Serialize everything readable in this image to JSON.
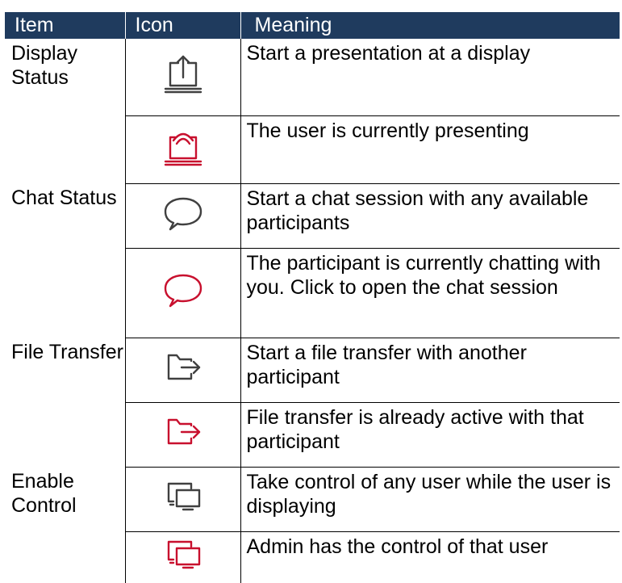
{
  "header": {
    "item": "Item",
    "icon": "Icon",
    "meaning": "Meaning"
  },
  "colors": {
    "header_bg": "#1f3b5e",
    "icon_default": "#404040",
    "icon_active": "#c8102e"
  },
  "rows": [
    {
      "item": "Display Status",
      "icon": "share-screen-icon",
      "icon_color": "default",
      "meaning": "Start a presentation at a display"
    },
    {
      "item": "",
      "icon": "presenting-icon",
      "icon_color": "active",
      "meaning": "The user is currently presenting"
    },
    {
      "item": "Chat Status",
      "icon": "chat-bubble-icon",
      "icon_color": "default",
      "meaning": "Start a chat session with any available participants"
    },
    {
      "item": "",
      "icon": "chat-bubble-icon",
      "icon_color": "active",
      "meaning": "The participant is currently chatting with you. Click to open the chat session"
    },
    {
      "item": "File Transfer",
      "icon": "folder-arrow-icon",
      "icon_color": "default",
      "meaning": "Start a file transfer with another participant"
    },
    {
      "item": "",
      "icon": "folder-arrow-icon",
      "icon_color": "active",
      "meaning": "File transfer is already active with that participant"
    },
    {
      "item": "Enable Control",
      "icon": "dual-monitor-icon",
      "icon_color": "default",
      "meaning": "Take control of any user while the user is displaying"
    },
    {
      "item": "",
      "icon": "dual-monitor-icon",
      "icon_color": "active",
      "meaning": "Admin has the control of that user"
    }
  ]
}
